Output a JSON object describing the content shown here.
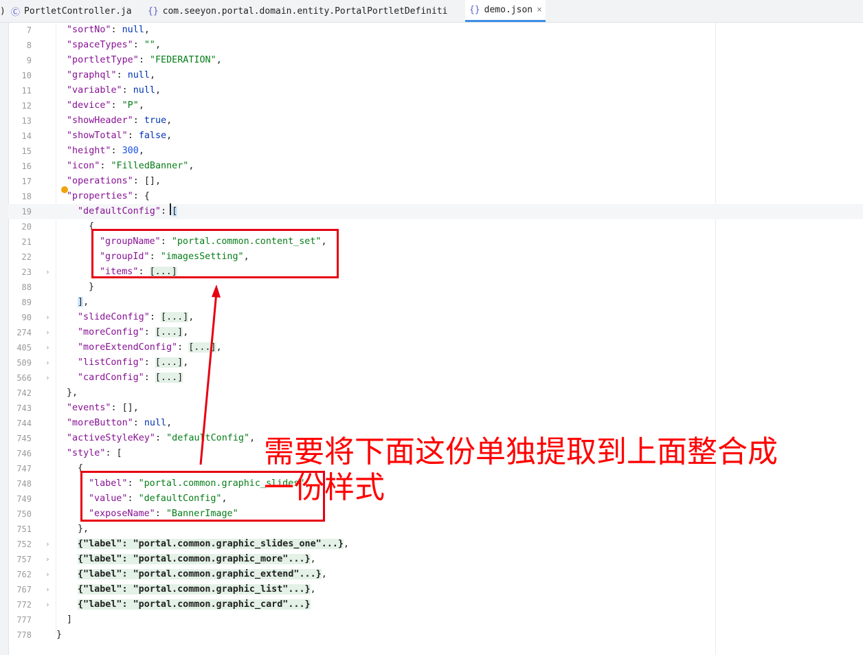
{
  "tabs": [
    {
      "icon": "Ⓒ",
      "label": "PortletController.ja",
      "active": false
    },
    {
      "icon": "{}",
      "label": "com.seeyon.portal.domain.entity.PortalPortletDefiniti",
      "active": false
    },
    {
      "icon": "{}",
      "label": "demo.json",
      "active": true,
      "close": "×"
    }
  ],
  "lines": [
    {
      "n": "7",
      "indent": 1,
      "tokens": [
        [
          "k",
          "\"sortNo\""
        ],
        [
          "p",
          ": "
        ],
        [
          "kw",
          "null"
        ],
        [
          "p",
          ","
        ]
      ]
    },
    {
      "n": "8",
      "indent": 1,
      "tokens": [
        [
          "k",
          "\"spaceTypes\""
        ],
        [
          "p",
          ": "
        ],
        [
          "s",
          "\"\""
        ],
        [
          "p",
          ","
        ]
      ]
    },
    {
      "n": "9",
      "indent": 1,
      "tokens": [
        [
          "k",
          "\"portletType\""
        ],
        [
          "p",
          ": "
        ],
        [
          "s",
          "\"FEDERATION\""
        ],
        [
          "p",
          ","
        ]
      ]
    },
    {
      "n": "10",
      "indent": 1,
      "tokens": [
        [
          "k",
          "\"graphql\""
        ],
        [
          "p",
          ": "
        ],
        [
          "kw",
          "null"
        ],
        [
          "p",
          ","
        ]
      ]
    },
    {
      "n": "11",
      "indent": 1,
      "tokens": [
        [
          "k",
          "\"variable\""
        ],
        [
          "p",
          ": "
        ],
        [
          "kw",
          "null"
        ],
        [
          "p",
          ","
        ]
      ]
    },
    {
      "n": "12",
      "indent": 1,
      "tokens": [
        [
          "k",
          "\"device\""
        ],
        [
          "p",
          ": "
        ],
        [
          "s",
          "\"P\""
        ],
        [
          "p",
          ","
        ]
      ]
    },
    {
      "n": "13",
      "indent": 1,
      "tokens": [
        [
          "k",
          "\"showHeader\""
        ],
        [
          "p",
          ": "
        ],
        [
          "kw",
          "true"
        ],
        [
          "p",
          ","
        ]
      ]
    },
    {
      "n": "14",
      "indent": 1,
      "tokens": [
        [
          "k",
          "\"showTotal\""
        ],
        [
          "p",
          ": "
        ],
        [
          "kw",
          "false"
        ],
        [
          "p",
          ","
        ]
      ]
    },
    {
      "n": "15",
      "indent": 1,
      "tokens": [
        [
          "k",
          "\"height\""
        ],
        [
          "p",
          ": "
        ],
        [
          "n",
          "300"
        ],
        [
          "p",
          ","
        ]
      ]
    },
    {
      "n": "16",
      "indent": 1,
      "tokens": [
        [
          "k",
          "\"icon\""
        ],
        [
          "p",
          ": "
        ],
        [
          "s",
          "\"FilledBanner\""
        ],
        [
          "p",
          ","
        ]
      ]
    },
    {
      "n": "17",
      "indent": 1,
      "tokens": [
        [
          "k",
          "\"operations\""
        ],
        [
          "p",
          ": [],"
        ]
      ]
    },
    {
      "n": "18",
      "indent": 1,
      "tokens": [
        [
          "k",
          "\"properties\""
        ],
        [
          "p",
          ": {"
        ]
      ]
    },
    {
      "n": "19",
      "indent": 2,
      "hl": true,
      "tokens": [
        [
          "k",
          "\"defaultConfig\""
        ],
        [
          "p",
          ": "
        ],
        [
          "brhl",
          "["
        ]
      ]
    },
    {
      "n": "20",
      "indent": 3,
      "tokens": [
        [
          "p",
          "{"
        ]
      ]
    },
    {
      "n": "21",
      "indent": 4,
      "tokens": [
        [
          "k",
          "\"groupName\""
        ],
        [
          "p",
          ": "
        ],
        [
          "s",
          "\"portal.common.content_set\""
        ],
        [
          "p",
          ","
        ]
      ]
    },
    {
      "n": "22",
      "indent": 4,
      "tokens": [
        [
          "k",
          "\"groupId\""
        ],
        [
          "p",
          ": "
        ],
        [
          "s",
          "\"imagesSetting\""
        ],
        [
          "p",
          ","
        ]
      ]
    },
    {
      "n": "23",
      "indent": 4,
      "fold": true,
      "tokens": [
        [
          "k",
          "\"items\""
        ],
        [
          "p",
          ": "
        ],
        [
          "coll",
          "[...]"
        ]
      ]
    },
    {
      "n": "88",
      "indent": 3,
      "tokens": [
        [
          "p",
          "}"
        ]
      ]
    },
    {
      "n": "89",
      "indent": 2,
      "tokens": [
        [
          "brhl",
          "]"
        ],
        [
          "p",
          ","
        ]
      ]
    },
    {
      "n": "90",
      "indent": 2,
      "fold": true,
      "tokens": [
        [
          "k",
          "\"slideConfig\""
        ],
        [
          "p",
          ": "
        ],
        [
          "coll",
          "[...]"
        ],
        [
          "p",
          ","
        ]
      ]
    },
    {
      "n": "274",
      "indent": 2,
      "fold": true,
      "tokens": [
        [
          "k",
          "\"moreConfig\""
        ],
        [
          "p",
          ": "
        ],
        [
          "coll",
          "[...]"
        ],
        [
          "p",
          ","
        ]
      ]
    },
    {
      "n": "405",
      "indent": 2,
      "fold": true,
      "tokens": [
        [
          "k",
          "\"moreExtendConfig\""
        ],
        [
          "p",
          ": "
        ],
        [
          "coll",
          "[...]"
        ],
        [
          "p",
          ","
        ]
      ]
    },
    {
      "n": "509",
      "indent": 2,
      "fold": true,
      "tokens": [
        [
          "k",
          "\"listConfig\""
        ],
        [
          "p",
          ": "
        ],
        [
          "coll",
          "[...]"
        ],
        [
          "p",
          ","
        ]
      ]
    },
    {
      "n": "566",
      "indent": 2,
      "fold": true,
      "tokens": [
        [
          "k",
          "\"cardConfig\""
        ],
        [
          "p",
          ": "
        ],
        [
          "coll",
          "[...]"
        ]
      ]
    },
    {
      "n": "742",
      "indent": 1,
      "tokens": [
        [
          "p",
          "},"
        ]
      ]
    },
    {
      "n": "743",
      "indent": 1,
      "tokens": [
        [
          "k",
          "\"events\""
        ],
        [
          "p",
          ": [],"
        ]
      ]
    },
    {
      "n": "744",
      "indent": 1,
      "tokens": [
        [
          "k",
          "\"moreButton\""
        ],
        [
          "p",
          ": "
        ],
        [
          "kw",
          "null"
        ],
        [
          "p",
          ","
        ]
      ]
    },
    {
      "n": "745",
      "indent": 1,
      "tokens": [
        [
          "k",
          "\"activeStyleKey\""
        ],
        [
          "p",
          ": "
        ],
        [
          "s",
          "\"defaultConfig\""
        ],
        [
          "p",
          ","
        ]
      ]
    },
    {
      "n": "746",
      "indent": 1,
      "tokens": [
        [
          "k",
          "\"style\""
        ],
        [
          "p",
          ": ["
        ]
      ]
    },
    {
      "n": "747",
      "indent": 2,
      "tokens": [
        [
          "p",
          "{"
        ]
      ]
    },
    {
      "n": "748",
      "indent": 3,
      "tokens": [
        [
          "k",
          "\"label\""
        ],
        [
          "p",
          ": "
        ],
        [
          "s",
          "\"portal.common.graphic_slides\""
        ],
        [
          "p",
          ","
        ]
      ]
    },
    {
      "n": "749",
      "indent": 3,
      "tokens": [
        [
          "k",
          "\"value\""
        ],
        [
          "p",
          ": "
        ],
        [
          "s",
          "\"defaultConfig\""
        ],
        [
          "p",
          ","
        ]
      ]
    },
    {
      "n": "750",
      "indent": 3,
      "tokens": [
        [
          "k",
          "\"exposeName\""
        ],
        [
          "p",
          ": "
        ],
        [
          "s",
          "\"BannerImage\""
        ]
      ]
    },
    {
      "n": "751",
      "indent": 2,
      "tokens": [
        [
          "p",
          "},"
        ]
      ]
    },
    {
      "n": "752",
      "indent": 2,
      "fold": true,
      "tokens": [
        [
          "collb",
          "{\"label\": \"portal.common.graphic_slides_one\"...}"
        ],
        [
          "p",
          ","
        ]
      ]
    },
    {
      "n": "757",
      "indent": 2,
      "fold": true,
      "tokens": [
        [
          "collb",
          "{\"label\": \"portal.common.graphic_more\"...}"
        ],
        [
          "p",
          ","
        ]
      ]
    },
    {
      "n": "762",
      "indent": 2,
      "fold": true,
      "tokens": [
        [
          "collb",
          "{\"label\": \"portal.common.graphic_extend\"...}"
        ],
        [
          "p",
          ","
        ]
      ]
    },
    {
      "n": "767",
      "indent": 2,
      "fold": true,
      "tokens": [
        [
          "collb",
          "{\"label\": \"portal.common.graphic_list\"...}"
        ],
        [
          "p",
          ","
        ]
      ]
    },
    {
      "n": "772",
      "indent": 2,
      "fold": true,
      "tokens": [
        [
          "collb",
          "{\"label\": \"portal.common.graphic_card\"...}"
        ]
      ]
    },
    {
      "n": "777",
      "indent": 1,
      "tokens": [
        [
          "p",
          "]"
        ]
      ]
    },
    {
      "n": "778",
      "indent": 0,
      "tokens": [
        [
          "p",
          "}"
        ]
      ]
    }
  ],
  "annotation": {
    "line1": "需要将下面这份单独提取到上面整合成",
    "line2": "一份样式"
  },
  "colors": {
    "box": "#e60012",
    "annotation": "#ff0000",
    "arrow": "#e60012"
  }
}
